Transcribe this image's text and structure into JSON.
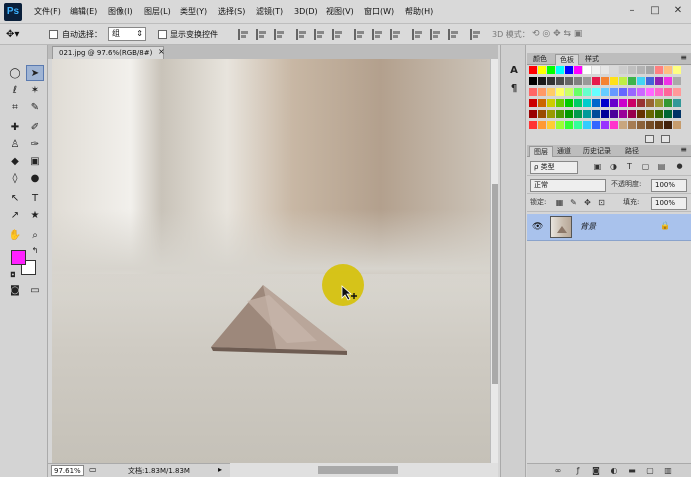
{
  "app": {
    "logo": "Ps",
    "menu": [
      "文件(F)",
      "编辑(E)",
      "图像(I)",
      "图层(L)",
      "类型(Y)",
      "选择(S)",
      "滤镜(T)",
      "3D(D)",
      "视图(V)",
      "窗口(W)",
      "帮助(H)"
    ],
    "window_controls": {
      "minimize": "–",
      "restore": "□",
      "close": "✕"
    }
  },
  "options": {
    "auto_select_label": "自动选择：",
    "auto_select_value": "组",
    "show_transform_label": "显示变换控件",
    "mode_3d_label": "3D 模式："
  },
  "document": {
    "tab_title": "021.jpg @ 97.6%(RGB/8#)",
    "tab_close": "×",
    "zoom": "97.61%",
    "doc_size": "文档:1.83M/1.83M"
  },
  "swatches_panel": {
    "tabs": [
      "颜色",
      "色板",
      "样式"
    ],
    "active_tab": 1,
    "colors": [
      "#ff0000",
      "#ffff00",
      "#00ff00",
      "#00ffff",
      "#0000ff",
      "#ff00ff",
      "#ffffff",
      "#f2f2f2",
      "#e6e6e6",
      "#d9d9d9",
      "#cccccc",
      "#bfbfbf",
      "#b3b3b3",
      "#a6a6a6",
      "#ff8080",
      "#ffbf80",
      "#ffff80",
      "#000000",
      "#1a1a1a",
      "#333333",
      "#4d4d4d",
      "#666666",
      "#808080",
      "#999999",
      "#e6194b",
      "#f58231",
      "#ffe119",
      "#bfef45",
      "#3cb44b",
      "#42d4f4",
      "#4363d8",
      "#911eb4",
      "#f032e6",
      "#a9a9a9",
      "#ff6666",
      "#ff9966",
      "#ffcc66",
      "#ffff66",
      "#ccff66",
      "#66ff66",
      "#66ffcc",
      "#66ffff",
      "#66ccff",
      "#6699ff",
      "#6666ff",
      "#9966ff",
      "#cc66ff",
      "#ff66ff",
      "#ff66cc",
      "#ff6699",
      "#ff9999",
      "#cc0000",
      "#cc6600",
      "#cccc00",
      "#66cc00",
      "#00cc00",
      "#00cc66",
      "#00cccc",
      "#0066cc",
      "#0000cc",
      "#6600cc",
      "#cc00cc",
      "#cc0066",
      "#993333",
      "#996633",
      "#999933",
      "#339933",
      "#339999",
      "#990000",
      "#994c00",
      "#999900",
      "#4c9900",
      "#009900",
      "#00994c",
      "#009999",
      "#004c99",
      "#000099",
      "#4c0099",
      "#990099",
      "#99004c",
      "#663300",
      "#666600",
      "#336600",
      "#006633",
      "#003366",
      "#ff3333",
      "#ff9933",
      "#ffcc33",
      "#99ff33",
      "#33ff33",
      "#33ff99",
      "#33ccff",
      "#3366ff",
      "#9933ff",
      "#ff33cc",
      "#c8a67e",
      "#a67c52",
      "#8c6239",
      "#754c24",
      "#603813",
      "#42210b",
      "#c69c6d"
    ]
  },
  "layers_panel": {
    "tabs": [
      "图层",
      "通道",
      "历史记录",
      "路径"
    ],
    "active_tab": 0,
    "filter_label": "ρ 类型",
    "blend_mode": "正常",
    "opacity_label": "不透明度:",
    "opacity_value": "100%",
    "lock_label": "锁定:",
    "fill_label": "填充:",
    "fill_value": "100%",
    "layers": [
      {
        "name": "背景",
        "visible": true,
        "locked": true
      }
    ]
  },
  "tools": {
    "foreground_color": "#ff20ff",
    "background_color": "#ffffff"
  }
}
